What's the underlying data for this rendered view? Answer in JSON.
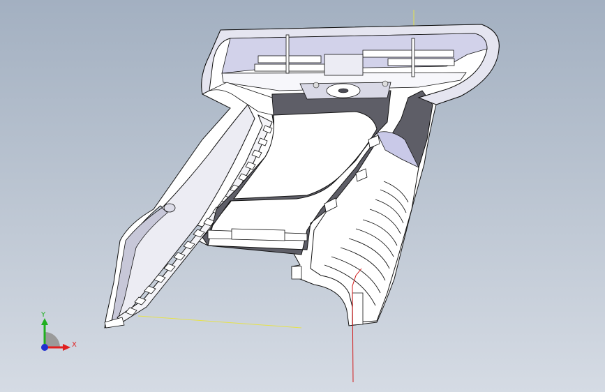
{
  "viewport": {
    "background_top": "#a3b0c1",
    "background_bottom": "#d5dbe4"
  },
  "model": {
    "icon": "3d-part-model",
    "body_color": "#ffffff",
    "interior_color": "#5f5f68",
    "edge_color": "#111111",
    "shade_color": "#c9c9e8"
  },
  "sketch_lines": {
    "yellow": "#e6e24a",
    "red": "#d11a1a"
  },
  "triad": {
    "x_label": "X",
    "y_label": "Y",
    "x_color": "#e02020",
    "y_color": "#20b020",
    "z_color": "#2030d0"
  }
}
